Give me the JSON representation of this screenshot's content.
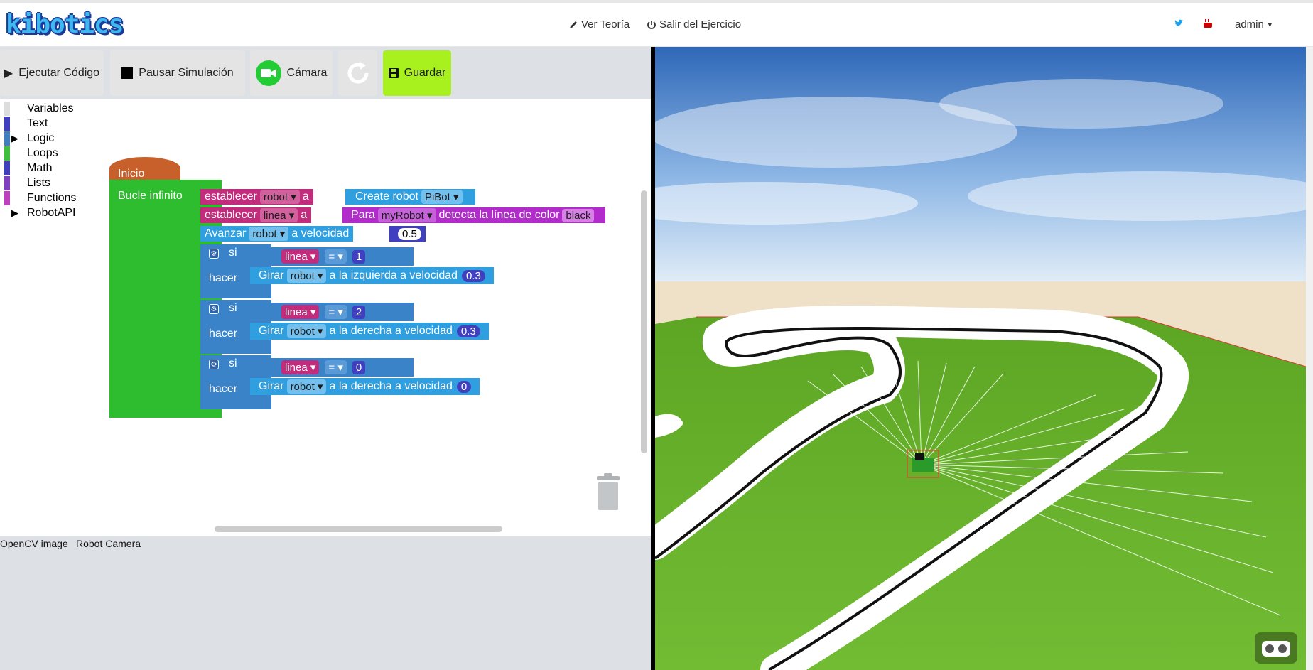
{
  "navbar": {
    "logo_text": "kibotics",
    "ver_teoria": "Ver Teoría",
    "salir": "Salir del Ejercicio",
    "user": "admin",
    "twitter_icon": "twitter-icon",
    "youtube_icon": "youtube-icon"
  },
  "toolbar": {
    "run_label": "Ejecutar Código",
    "pause_label": "Pausar Simulación",
    "camera_label": "Cámara",
    "save_label": "Guardar",
    "save_color": "#a8f01e",
    "camera_color": "#22cc33"
  },
  "toolbox": {
    "categories": [
      {
        "label": "Variables",
        "color": "#dddddd",
        "expandable": false
      },
      {
        "label": "Text",
        "color": "#3f3fbf",
        "expandable": false
      },
      {
        "label": "Logic",
        "color": "#3f7fbf",
        "expandable": true
      },
      {
        "label": "Loops",
        "color": "#3fbf3f",
        "expandable": false
      },
      {
        "label": "Math",
        "color": "#3f3fbf",
        "expandable": false
      },
      {
        "label": "Lists",
        "color": "#7f3fbf",
        "expandable": false
      },
      {
        "label": "Functions",
        "color": "#bf3fbf",
        "expandable": false
      },
      {
        "label": "RobotAPI",
        "color": "#ffffff",
        "expandable": true
      }
    ]
  },
  "blocks": {
    "inicio": "Inicio",
    "bucle": "Bucle infinito",
    "set1": {
      "prefix": "establecer",
      "var": "robot",
      "a": "a",
      "fn": "Create robot",
      "arg": "PiBot"
    },
    "set2": {
      "prefix": "establecer",
      "var": "linea",
      "a": "a",
      "fn": "Para",
      "arg": "myRobot",
      "rest": "detecta la línea de color",
      "color": "black"
    },
    "advance": {
      "text": "Avanzar",
      "var": "robot",
      "rest": "a velocidad",
      "val": "0.5"
    },
    "if_blocks": [
      {
        "si": "si",
        "var": "linea",
        "op": "=",
        "val": "1",
        "hacer": "hacer",
        "action": "Girar",
        "robot": "robot",
        "dir": "a la izquierda a velocidad",
        "speed": "0.3"
      },
      {
        "si": "si",
        "var": "linea",
        "op": "=",
        "val": "2",
        "hacer": "hacer",
        "action": "Girar",
        "robot": "robot",
        "dir": "a la derecha a velocidad",
        "speed": "0.3"
      },
      {
        "si": "si",
        "var": "linea",
        "op": "=",
        "val": "0",
        "hacer": "hacer",
        "action": "Girar",
        "robot": "robot",
        "dir": "a la derecha a velocidad",
        "speed": "0"
      }
    ]
  },
  "bottom_tabs": {
    "opencv": "OpenCV image",
    "robot_camera": "Robot Camera"
  }
}
